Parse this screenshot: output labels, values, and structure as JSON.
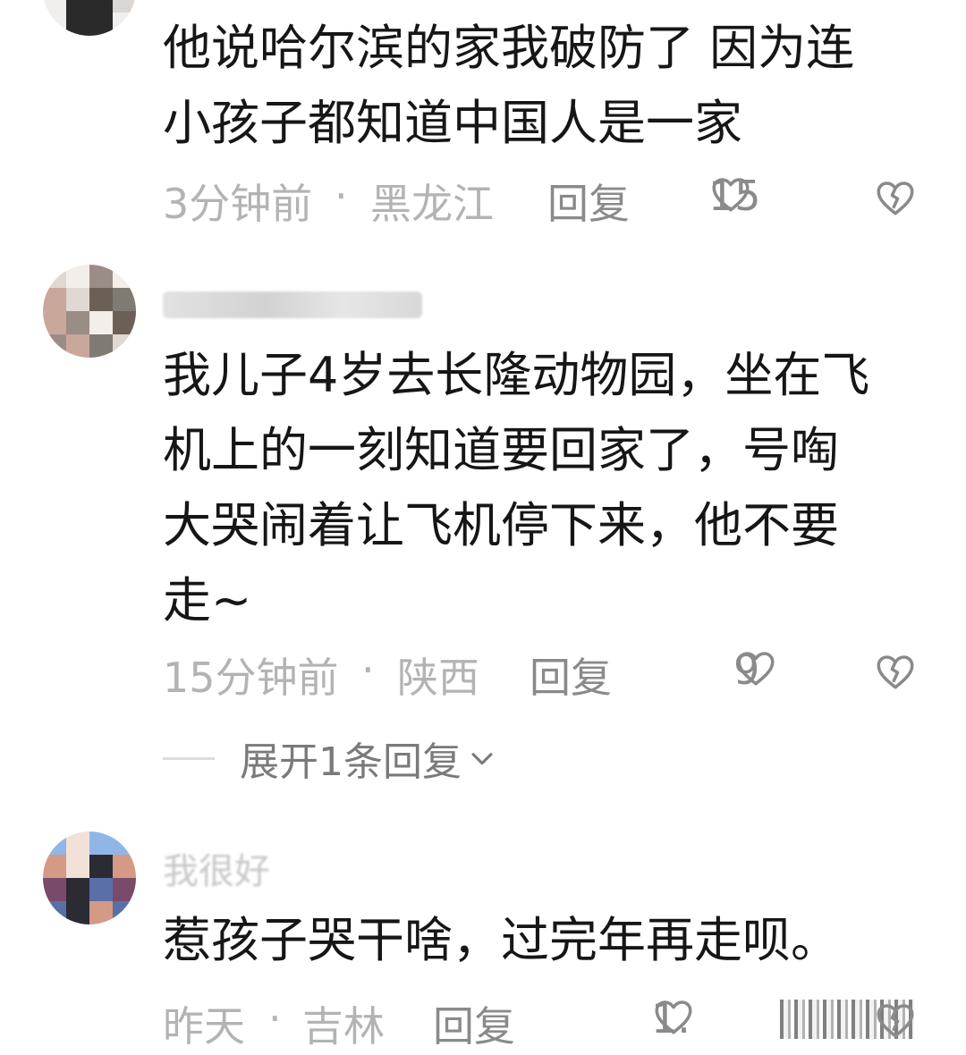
{
  "comments": [
    {
      "username": "",
      "lines": [
        "他说哈尔滨的家我破防了 因为连",
        "小孩子都知道中国人是一家"
      ],
      "time": "3分钟前",
      "location": "黑龙江",
      "reply_label": "回复",
      "likes": "15",
      "avatar_colors": [
        "#dcd6d2",
        "#2a2a2a",
        "#8d7e78",
        "#f1efee"
      ]
    },
    {
      "username": "",
      "lines": [
        "我儿子4岁去长隆动物园，坐在飞",
        "机上的一刻知道要回家了，号啕",
        "大哭闹着让飞机停下来，他不要",
        "走~"
      ],
      "time": "15分钟前",
      "location": "陕西",
      "reply_label": "回复",
      "likes": "9",
      "expand_label": "展开1条回复",
      "avatar_colors": [
        "#c9a79a",
        "#6c5f55",
        "#e0d8d2",
        "#9a8d85",
        "#f3eeea",
        "#7f7a72"
      ]
    },
    {
      "username": "我很好",
      "lines": [
        "惹孩子哭干啥，过完年再走呗。"
      ],
      "time": "昨天",
      "location": "吉林",
      "reply_label": "回复",
      "likes": "1.",
      "avatar_colors": [
        "#8fb6e6",
        "#5a6fa8",
        "#2c2a33",
        "#d49a86",
        "#f2e1d8",
        "#7a4a6a"
      ]
    }
  ],
  "separator": "·",
  "colors": {
    "text": "#161616",
    "meta": "#b3b3b3",
    "action": "#8a8a8a"
  },
  "icons": [
    "heart-outline-icon",
    "broken-heart-icon",
    "chevron-down-icon"
  ]
}
